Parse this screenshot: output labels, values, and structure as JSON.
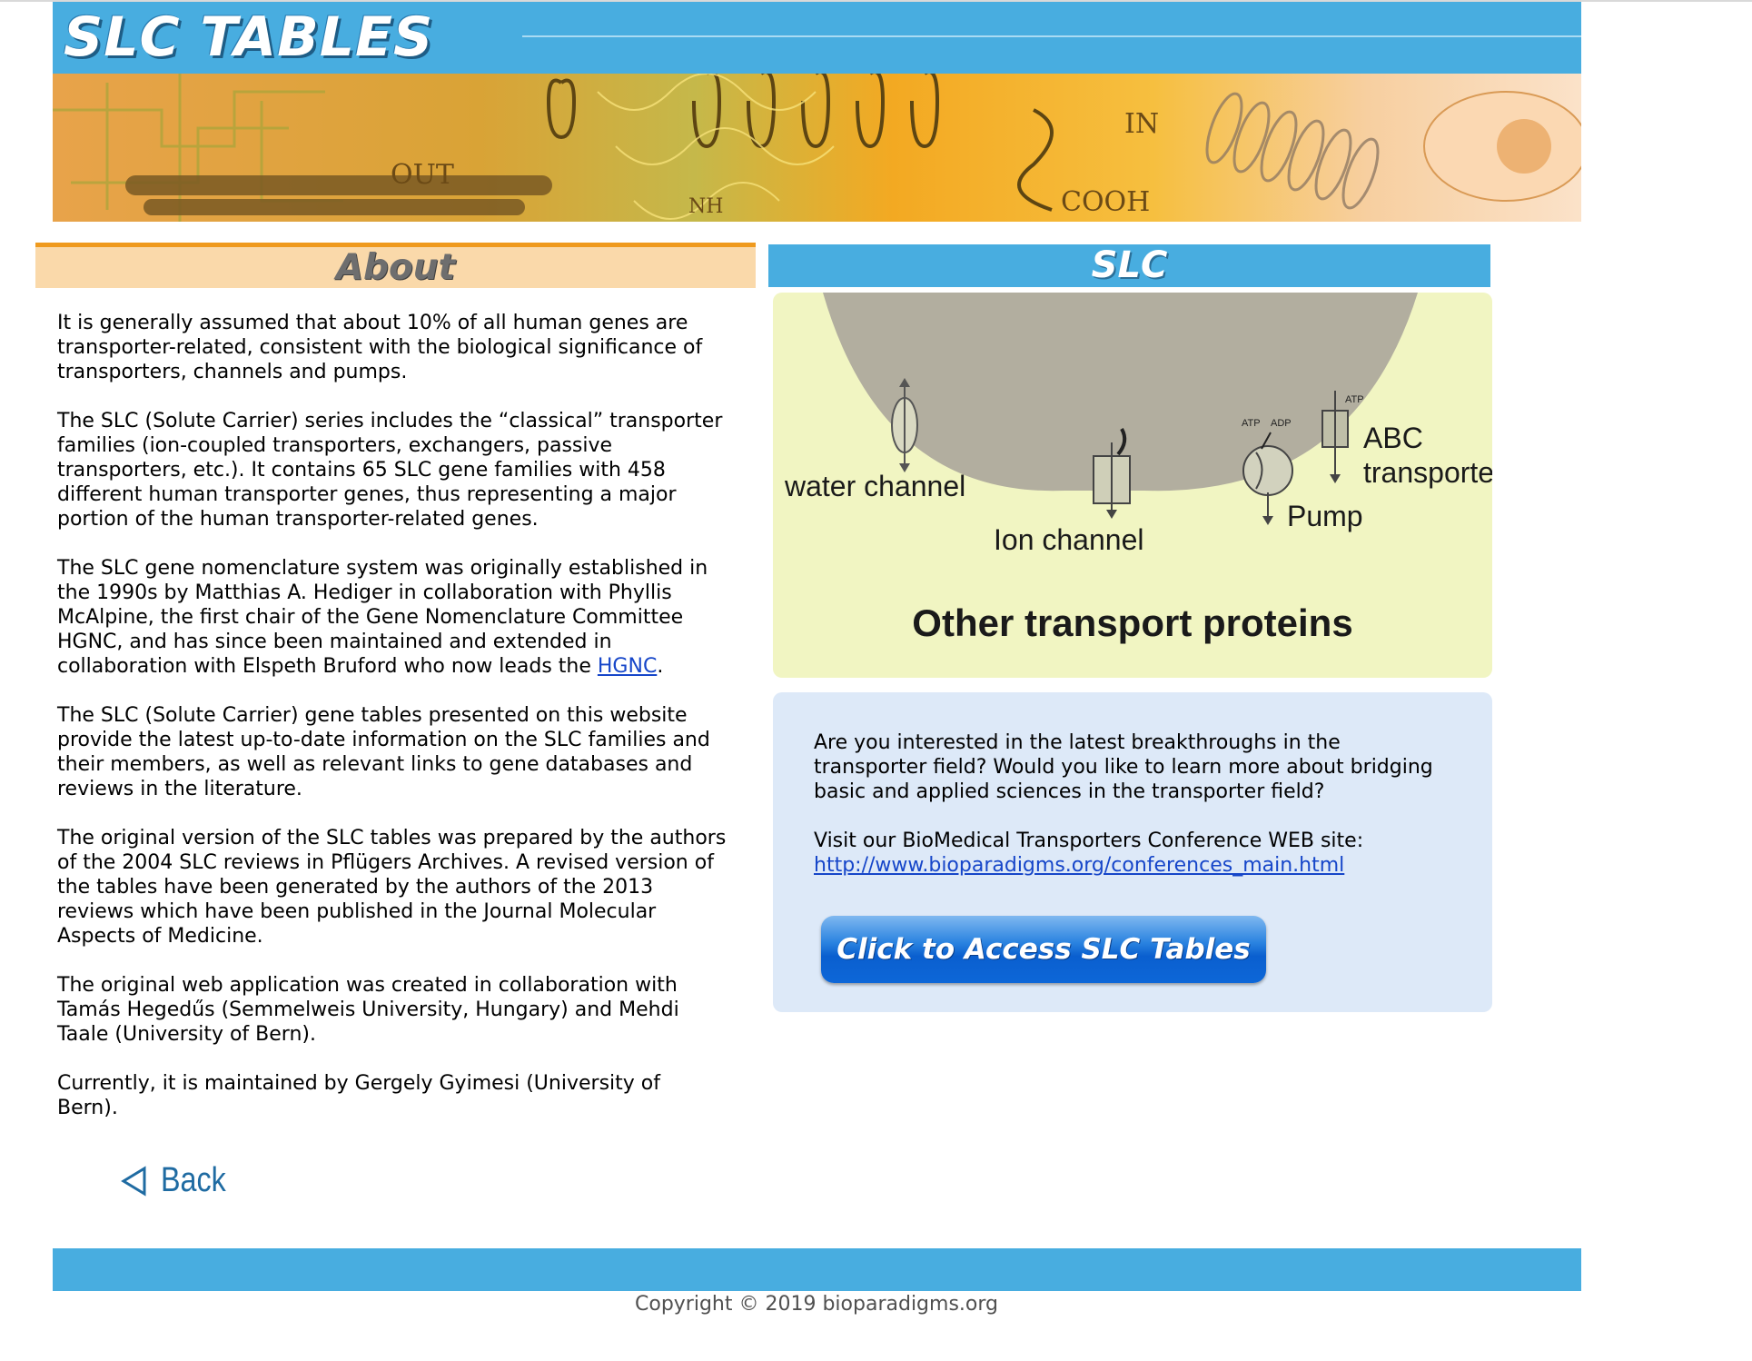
{
  "header": {
    "logo": "SLC TABLES"
  },
  "banner": {
    "labels": [
      "OUT",
      "IN",
      "NH",
      "COOH"
    ]
  },
  "about": {
    "heading": "About",
    "paragraphs": [
      "It is generally assumed that about 10% of all human genes are\ntransporter-related, consistent with the biological significance of\ntransporters, channels and pumps.",
      "The SLC (Solute Carrier) series includes the “classical” transporter\nfamilies (ion-coupled transporters, exchangers, passive\ntransporters, etc.). It contains 65 SLC gene families with 458\ndifferent human transporter genes, thus representing a major\nportion of the human transporter-related genes.",
      "The SLC (Solute Carrier) gene tables presented on this website\nprovide the latest up-to-date information on the SLC families and\ntheir members, as well as relevant links to gene databases and\nreviews in the literature.",
      "The original version of the SLC tables was prepared by the authors\nof the 2004 SLC reviews in Pflügers Archives. A revised version of\nthe tables have been generated by the authors of the 2013\nreviews which have been published in the Journal Molecular\nAspects of Medicine.",
      "The original web application was created in collaboration with\nTamás Hegedűs (Semmelweis University, Hungary) and Mehdi\nTaale (University of Bern).",
      "Currently, it is maintained by Gergely Gyimesi (University of\nBern)."
    ],
    "nomenclature_text": "The SLC gene nomenclature system was originally established in\nthe 1990s by Matthias A. Hediger in collaboration with Phyllis\nMcAlpine, the first chair of the Gene Nomenclature Committee\nHGNC, and has since been maintained and extended in\ncollaboration with Elspeth Bruford who now leads the ",
    "hgnc_link": "HGNC",
    "nomenclature_end": ".",
    "back_label": "Back"
  },
  "slc": {
    "heading": "SLC",
    "diagram": {
      "labels": {
        "water_channel": "water channel",
        "ion_channel": "Ion channel",
        "pump": "Pump",
        "abc_line1": "ABC",
        "abc_line2": "transporter",
        "atp1": "ATP",
        "adp": "ADP",
        "atp2": "ATP"
      },
      "title": "Other transport proteins"
    },
    "info": {
      "question": "Are you interested in the latest breakthroughs in the transporter field? Would you like to learn more about bridging basic and applied sciences in the transporter field?",
      "visit_text": "Visit our BioMedical Transporters Conference WEB site:",
      "conference_link": "http://www.bioparadigms.org/conferences_main.html",
      "access_button": "Click to Access SLC Tables"
    }
  },
  "footer": {
    "copyright": "Copyright © 2019 bioparadigms.org"
  },
  "colors": {
    "header_blue": "#48ade0",
    "about_orange": "#ef9a1e",
    "about_bg": "#fad9aa",
    "diagram_bg": "#f1f5c2",
    "info_bg": "#dde9f8",
    "link": "#1646c9"
  }
}
